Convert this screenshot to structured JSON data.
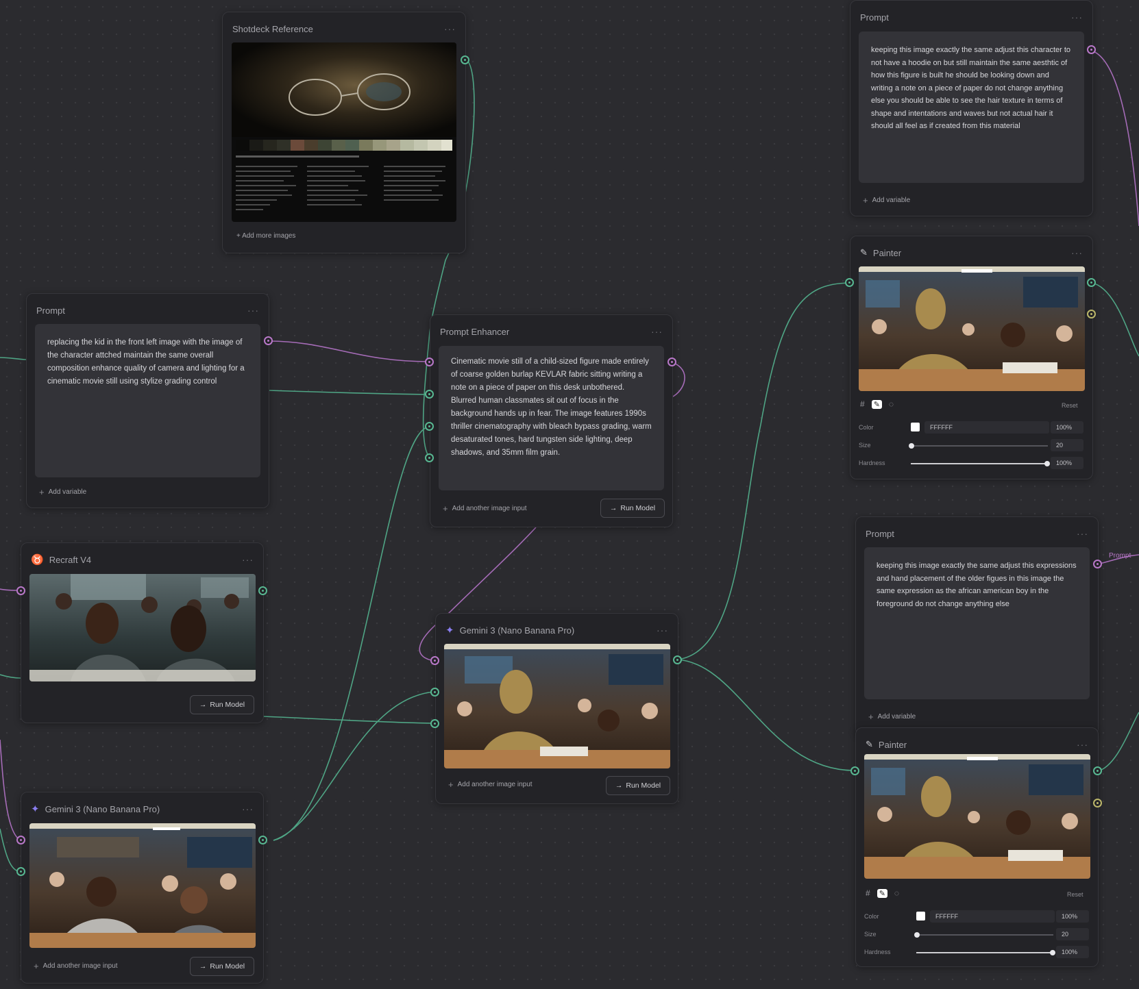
{
  "shotdeck": {
    "title": "Shotdeck Reference",
    "add_more": "+ Add more images"
  },
  "prompt_left": {
    "title": "Prompt",
    "text": "replacing the kid in the front left image with the image of the character attched maintain the same overall composition enhance quality of camera and lighting for a cinematic movie still using stylize grading control",
    "add_variable": "Add variable"
  },
  "prompt_enhancer": {
    "title": "Prompt Enhancer",
    "text": "Cinematic movie still of a child-sized figure made entirely of coarse golden burlap KEVLAR fabric sitting  writing a note on a piece of paper on this desk unbothered. Blurred human classmates sit out of focus in the background hands up in fear. The image features 1990s thriller cinematography with bleach bypass grading, warm desaturated tones, hard tungsten side lighting, deep shadows, and 35mm film grain.",
    "add_input": "Add another image input",
    "run": "Run Model"
  },
  "recraft": {
    "title": "Recraft V4",
    "run": "Run Model"
  },
  "gemini_left": {
    "title": "Gemini 3 (Nano Banana Pro)",
    "add_input": "Add another image input",
    "run": "Run Model"
  },
  "gemini_center": {
    "title": "Gemini 3 (Nano Banana Pro)",
    "add_input": "Add another image input",
    "run": "Run Model"
  },
  "prompt_top_right": {
    "title": "Prompt",
    "text": "keeping this image exactly the same adjust this character to not have a hoodie on but still maintain the same aesthtic of how this figure is built he should be looking down and writing a note on a piece of paper do not change anything else you should be able to see the hair texture in terms of shape and intentations and waves but not actual hair it should all feel as if created from this material",
    "add_variable": "Add variable"
  },
  "painter_top": {
    "title": "Painter",
    "reset": "Reset",
    "color_label": "Color",
    "color_value": "FFFFFF",
    "color_opacity": "100%",
    "size_label": "Size",
    "size_value": "20",
    "hardness_label": "Hardness",
    "hardness_value": "100%"
  },
  "prompt_mid_right": {
    "title": "Prompt",
    "text": "keeping this image exactly the same adjust this expressions and hand placement of the older figues in this image the same expression as the african american boy in the foreground do not change anything else",
    "add_variable": "Add variable"
  },
  "painter_bottom": {
    "title": "Painter",
    "reset": "Reset",
    "color_label": "Color",
    "color_value": "FFFFFF",
    "color_opacity": "100%",
    "size_label": "Size",
    "size_value": "20",
    "hardness_label": "Hardness",
    "hardness_value": "100%"
  },
  "edge_label": "Prompt",
  "colors": {
    "canvas": "#2b2b2f",
    "node": "#232327",
    "text_port": "#b978c9",
    "image_port": "#58b892",
    "mask_port": "#bcb76a"
  },
  "icons": {
    "recraft": "recraft-logo-icon",
    "gemini": "sparkle-icon",
    "painter": "brush-icon"
  }
}
